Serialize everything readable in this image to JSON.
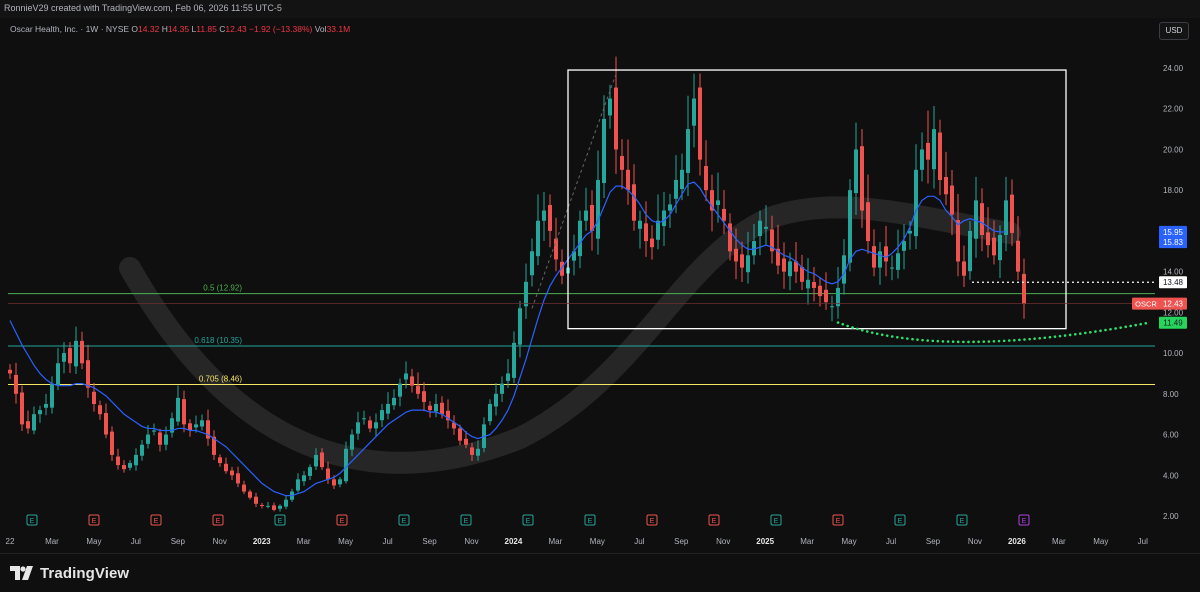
{
  "header": {
    "credit": "RonnieV29 created with TradingView.com, Feb 06, 2026 11:55 UTC-5",
    "symbol_line": "Oscar Health, Inc. · 1W · NYSE",
    "open_label": "O",
    "open": "14.32",
    "high_label": "H",
    "high": "14.35",
    "low_label": "L",
    "low": "11.85",
    "close_label": "C",
    "close": "12.43",
    "change": "−1.92 (−13.38%)",
    "vol_label": "Vol",
    "volume": "33.1M",
    "currency_button": "USD"
  },
  "footer": {
    "brand": "TradingView",
    "logo_icon": "tradingview-logo-icon"
  },
  "colors": {
    "background": "#0f0f0f",
    "up": "#26a69a",
    "down": "#ef5350",
    "ma": "#2962ff",
    "fib_05": "#4caf50",
    "fib_0618": "#26a69a",
    "fib_0705": "#f5e663",
    "pattern_dots": "#2ee06b",
    "box": "#ffffff",
    "arc": "#3a3a3a"
  },
  "chart_data": {
    "type": "candlestick",
    "title": "Oscar Health, Inc. · 1W · NYSE",
    "ylim": [
      2,
      24
    ],
    "price_scale": "linear",
    "y_ticks": [
      "2.00",
      "4.00",
      "6.00",
      "8.00",
      "10.00",
      "12.00",
      "14.00",
      "16.00",
      "18.00",
      "20.00",
      "22.00",
      "24.00"
    ],
    "x_ticks": [
      "22",
      "Mar",
      "May",
      "Jul",
      "Sep",
      "Nov",
      "2023",
      "Mar",
      "May",
      "Jul",
      "Sep",
      "Nov",
      "2024",
      "Mar",
      "May",
      "Jul",
      "Sep",
      "Nov",
      "2025",
      "Mar",
      "May",
      "Jul",
      "Sep",
      "Nov",
      "2026",
      "Mar",
      "May",
      "Jul"
    ],
    "fib_levels": [
      {
        "label": "0.5 (12.92)",
        "value": 12.92
      },
      {
        "label": "0.618 (10.35)",
        "value": 10.35
      },
      {
        "label": "0.705 (8.46)",
        "value": 8.46
      }
    ],
    "price_labels": [
      {
        "text": "15.95",
        "value": 15.95,
        "bg": "#2962ff",
        "fg": "#ffffff"
      },
      {
        "text": "15.83",
        "value": 15.45,
        "bg": "#2962ff",
        "fg": "#ffffff"
      },
      {
        "text": "13.48",
        "value": 13.48,
        "bg": "#ffffff",
        "fg": "#131722"
      },
      {
        "text": "12.43",
        "value": 12.43,
        "bg": "#ef5350",
        "fg": "#ffffff",
        "tag": "OSCR"
      },
      {
        "text": "11.49",
        "value": 11.49,
        "bg": "#26d65c",
        "fg": "#131722"
      }
    ],
    "earnings_markers": [
      "E",
      "E",
      "E",
      "E",
      "E",
      "E",
      "E",
      "E",
      "E",
      "E",
      "E",
      "E",
      "E",
      "E",
      "E",
      "E",
      "E"
    ],
    "series": [
      {
        "name": "OSCR",
        "kind": "weekly-candles",
        "start": "2022-01",
        "close": [
          9.0,
          8.0,
          6.5,
          6.3,
          7.0,
          7.2,
          7.5,
          8.5,
          9.5,
          10.0,
          9.5,
          10.6,
          9.5,
          8.3,
          7.5,
          7.0,
          6.0,
          5.0,
          4.5,
          4.3,
          4.6,
          5.0,
          5.5,
          6.0,
          6.2,
          5.5,
          6.0,
          6.8,
          7.8,
          6.5,
          6.2,
          6.5,
          6.7,
          5.8,
          5.0,
          4.6,
          4.2,
          4.0,
          3.6,
          3.2,
          2.9,
          2.6,
          2.5,
          2.5,
          2.3,
          2.5,
          2.8,
          3.2,
          3.8,
          4.0,
          4.4,
          5.0,
          4.4,
          3.8,
          3.5,
          3.8,
          5.3,
          6.0,
          6.6,
          6.8,
          6.3,
          6.6,
          7.2,
          7.5,
          7.8,
          8.5,
          9.0,
          8.4,
          8.0,
          7.6,
          7.2,
          7.5,
          7.0,
          6.7,
          6.3,
          5.7,
          5.5,
          5.0,
          5.3,
          6.5,
          7.5,
          8.0,
          8.5,
          9.0,
          10.5,
          12.2,
          13.5,
          15.0,
          16.5,
          17.0,
          16.0,
          14.6,
          13.8,
          14.2,
          15.0,
          16.5,
          17.0,
          16.0,
          18.5,
          21.5,
          22.5,
          20.0,
          19.0,
          18.0,
          16.5,
          16.5,
          15.5,
          15.2,
          16.5,
          17.0,
          17.3,
          18.5,
          19.0,
          21.0,
          22.5,
          19.5,
          18.0,
          17.0,
          17.5,
          16.5,
          15.0,
          14.5,
          14.2,
          14.8,
          15.5,
          16.5,
          16.2,
          15.0,
          14.3,
          14.0,
          14.5,
          14.0,
          13.5,
          13.6,
          13.2,
          12.8,
          12.5,
          12.3,
          13.2,
          14.8,
          18.0,
          20.0,
          17.0,
          15.5,
          14.2,
          15.0,
          14.5,
          14.2,
          14.9,
          15.5,
          16.0,
          19.0,
          20.0,
          19.5,
          21.0,
          18.5,
          17.8,
          16.8,
          14.5,
          13.8,
          16.0,
          17.5,
          15.8,
          15.3,
          14.8,
          15.8,
          17.5,
          15.9,
          14.0,
          12.43
        ]
      },
      {
        "name": "MA",
        "kind": "moving-average",
        "values": [
          11.6,
          11.0,
          10.4,
          9.9,
          9.4,
          9.0,
          8.7,
          8.5,
          8.4,
          8.4,
          8.4,
          8.5,
          8.5,
          8.4,
          8.3,
          8.1,
          7.9,
          7.6,
          7.3,
          7.0,
          6.8,
          6.6,
          6.4,
          6.3,
          6.3,
          6.2,
          6.2,
          6.2,
          6.3,
          6.3,
          6.2,
          6.2,
          6.1,
          6.0,
          5.8,
          5.6,
          5.4,
          5.1,
          4.8,
          4.5,
          4.2,
          3.9,
          3.6,
          3.4,
          3.2,
          3.1,
          3.0,
          3.0,
          3.1,
          3.2,
          3.4,
          3.6,
          3.7,
          3.8,
          3.9,
          4.1,
          4.4,
          4.7,
          5.0,
          5.3,
          5.6,
          5.9,
          6.2,
          6.5,
          6.7,
          6.9,
          7.1,
          7.2,
          7.2,
          7.2,
          7.1,
          7.1,
          7.0,
          6.8,
          6.6,
          6.4,
          6.1,
          5.9,
          5.8,
          5.9,
          6.0,
          6.3,
          6.7,
          7.2,
          7.9,
          8.8,
          9.7,
          10.7,
          11.7,
          12.6,
          13.3,
          13.8,
          14.2,
          14.6,
          15.0,
          15.4,
          15.8,
          16.0,
          16.5,
          17.2,
          17.9,
          18.2,
          18.2,
          18.0,
          17.7,
          17.3,
          16.8,
          16.5,
          16.4,
          16.5,
          16.8,
          17.3,
          17.8,
          18.3,
          18.4,
          18.1,
          17.6,
          17.2,
          16.8,
          16.4,
          16.0,
          15.6,
          15.3,
          15.1,
          15.1,
          15.2,
          15.3,
          15.2,
          15.0,
          14.8,
          14.7,
          14.5,
          14.2,
          14.0,
          13.9,
          13.7,
          13.5,
          13.4,
          13.5,
          13.9,
          14.6,
          15.0,
          15.1,
          15.0,
          14.9,
          14.8,
          14.7,
          14.9,
          15.2,
          15.6,
          16.2,
          17.0,
          17.5,
          17.7,
          17.7,
          17.5,
          17.0,
          16.7,
          16.3,
          16.5,
          16.6,
          16.5,
          16.4,
          16.2,
          16.0,
          15.95,
          15.95
        ]
      }
    ]
  }
}
